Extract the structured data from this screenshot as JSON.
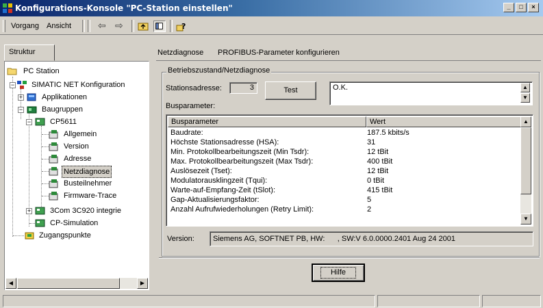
{
  "window": {
    "title": "Konfigurations-Konsole \"PC-Station einstellen\"",
    "minimize": "_",
    "maximize": "□",
    "close": "×"
  },
  "menu": {
    "vorgang": "Vorgang",
    "ansicht": "Ansicht"
  },
  "left": {
    "tab": "Struktur",
    "tree": [
      {
        "label": "PC Station",
        "icon": "folder-icon"
      },
      {
        "label": "SIMATIC NET Konfiguration",
        "icon": "network-icon"
      },
      {
        "label": "Applikationen",
        "icon": "applications-icon"
      },
      {
        "label": "Baugruppen",
        "icon": "modules-icon"
      },
      {
        "label": "CP5611",
        "icon": "card-icon"
      },
      {
        "label": "Allgemein",
        "icon": "property-icon"
      },
      {
        "label": "Version",
        "icon": "property-icon"
      },
      {
        "label": "Adresse",
        "icon": "property-icon"
      },
      {
        "label": "Netzdiagnose",
        "icon": "property-icon"
      },
      {
        "label": "Busteilnehmer",
        "icon": "property-icon"
      },
      {
        "label": "Firmware-Trace",
        "icon": "property-icon"
      },
      {
        "label": "3Com 3C920 integrie",
        "icon": "card-icon"
      },
      {
        "label": "CP-Simulation",
        "icon": "card-icon"
      },
      {
        "label": "Zugangspunkte",
        "icon": "access-point-icon"
      }
    ]
  },
  "right": {
    "header_title": "Netzdiagnose",
    "header_subtitle": "PROFIBUS-Parameter konfigurieren",
    "group_title": "Betriebszustand/Netzdiagnose",
    "station_label": "Stationsadresse:",
    "station_value": "3",
    "test_button": "Test",
    "result_text": "O.K.",
    "bus_label": "Busparameter:",
    "col_param": "Busparameter",
    "col_value": "Wert",
    "rows": [
      {
        "param": "Baudrate:",
        "value": "187.5 kbits/s"
      },
      {
        "param": "Höchste Stationsadresse (HSA):",
        "value": "31"
      },
      {
        "param": "Min. Protokollbearbeitungszeit (Min Tsdr):",
        "value": "12 tBit"
      },
      {
        "param": "Max. Protokollbearbeitungszeit (Max Tsdr):",
        "value": "400 tBit"
      },
      {
        "param": "Auslösezeit (Tset):",
        "value": "12 tBit"
      },
      {
        "param": "Modulatorausklingzeit (Tqui):",
        "value": "0 tBit"
      },
      {
        "param": "Warte-auf-Empfang-Zeit (tSlot):",
        "value": "415 tBit"
      },
      {
        "param": "Gap-Aktualisierungsfaktor:",
        "value": "5"
      },
      {
        "param": "Anzahl Aufrufwiederholungen (Retry Limit):",
        "value": "2"
      }
    ],
    "version_label": "Version:",
    "version_value": "Siemens AG, SOFTNET PB, HW:      , SW:V 6.0.0000.2401 Aug 24 2001",
    "help_button": "Hilfe"
  },
  "colors": {
    "titlebar_start": "#0a246a",
    "titlebar_end": "#a6caf0",
    "face": "#d4d0c8"
  }
}
